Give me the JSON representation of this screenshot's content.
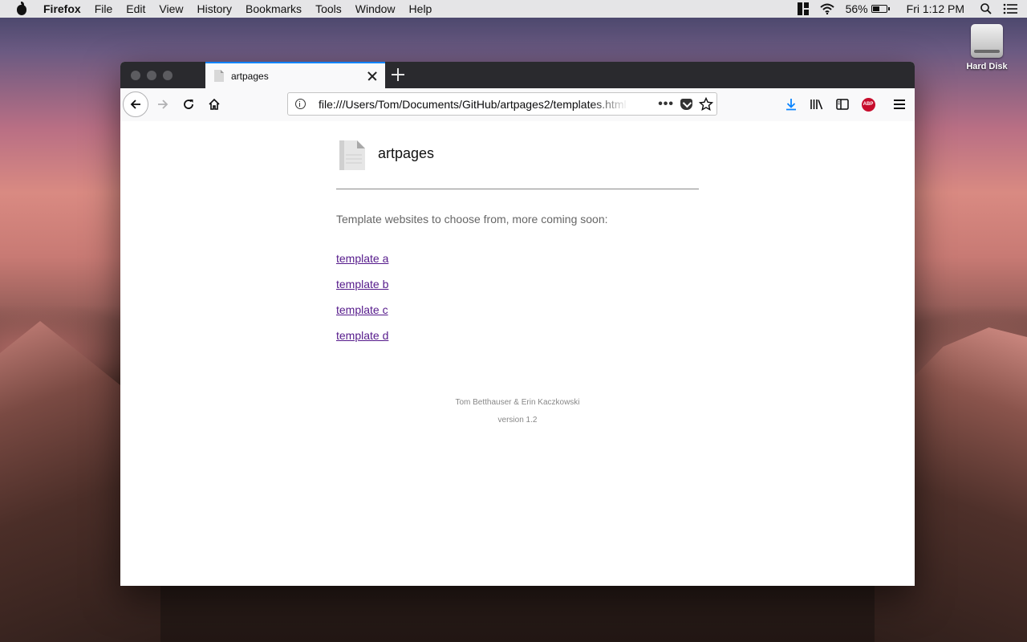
{
  "menubar": {
    "app_name": "Firefox",
    "items": [
      "File",
      "Edit",
      "View",
      "History",
      "Bookmarks",
      "Tools",
      "Window",
      "Help"
    ],
    "battery_percent": "56%",
    "battery_level": 0.56,
    "clock": "Fri 1:12 PM"
  },
  "desktop": {
    "hard_disk_label": "Hard Disk"
  },
  "browser": {
    "tab_title": "artpages",
    "url": "file:///Users/Tom/Documents/GitHub/artpages2/templates.html",
    "accent_color": "#0a84ff"
  },
  "page": {
    "site_title": "artpages",
    "intro": "Template websites to choose from, more coming soon:",
    "links": [
      "template a",
      "template b",
      "template c",
      "template d"
    ],
    "link_color": "#551a8b",
    "footer_authors": "Tom Betthauser & Erin Kaczkowski",
    "footer_version": "version 1.2"
  }
}
